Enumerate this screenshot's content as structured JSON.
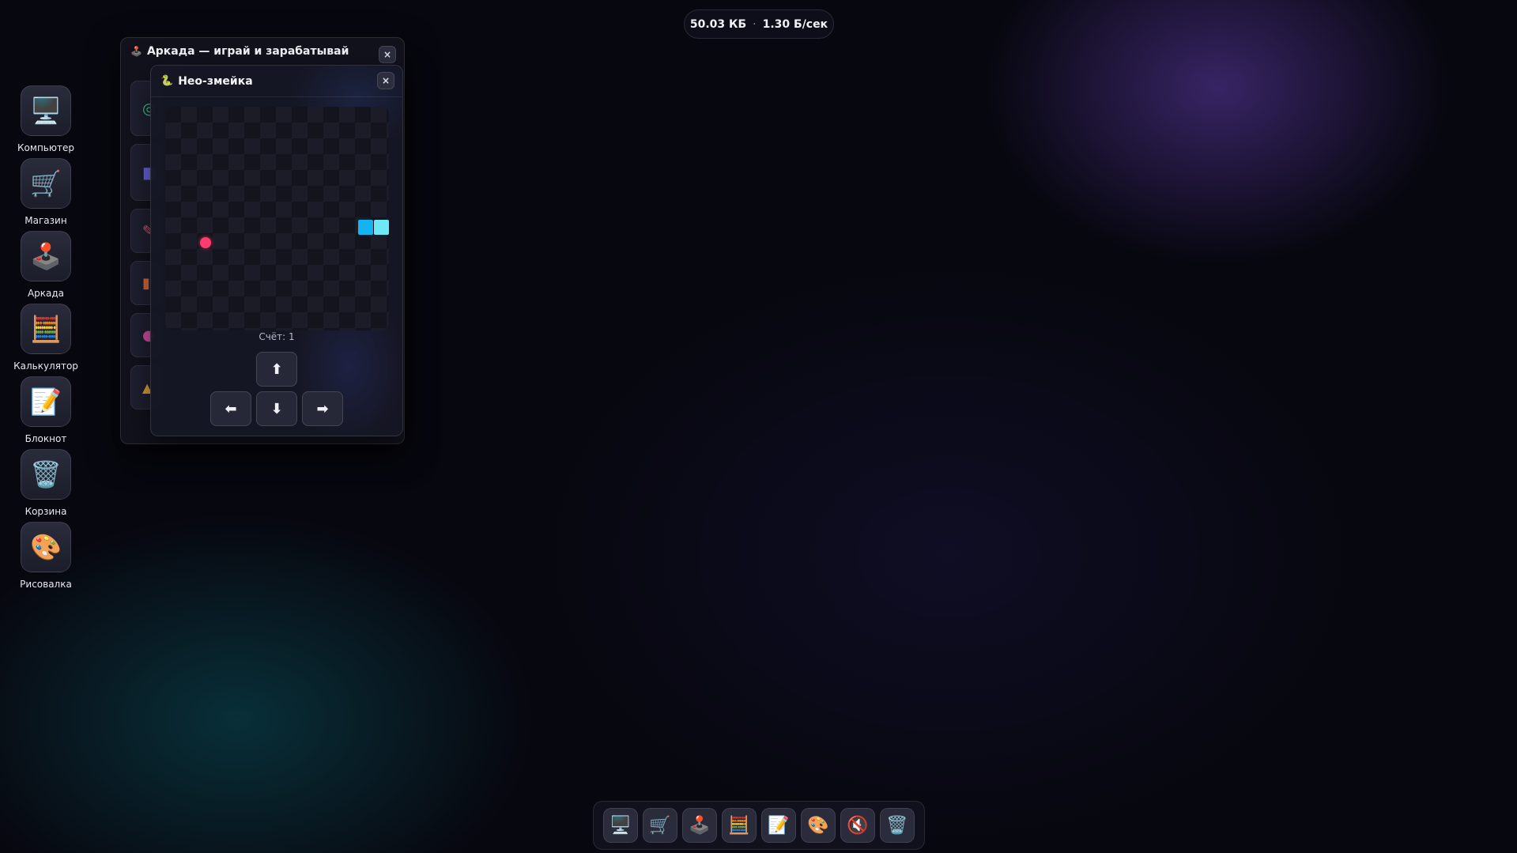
{
  "status": {
    "size": "50.03 КБ",
    "separator": "·",
    "rate": "1.30 Б/сек"
  },
  "desktop": {
    "items": [
      {
        "label": "Компьютер",
        "icon": "computer-icon",
        "glyph": "🖥️"
      },
      {
        "label": "Магазин",
        "icon": "cart-icon",
        "glyph": "🛒"
      },
      {
        "label": "Аркада",
        "icon": "joystick-icon",
        "glyph": "🕹️"
      },
      {
        "label": "Калькулятор",
        "icon": "abacus-icon",
        "glyph": "🧮"
      },
      {
        "label": "Блокнот",
        "icon": "notepad-icon",
        "glyph": "📝"
      },
      {
        "label": "Корзина",
        "icon": "trash-icon",
        "glyph": "🗑️"
      },
      {
        "label": "Рисовалка",
        "icon": "palette-icon",
        "glyph": "🎨"
      }
    ]
  },
  "arcade": {
    "title": "Аркада — играй и зарабатывай",
    "close": "×",
    "icon_glyph": "🕹️"
  },
  "snake": {
    "title": "Нео-змейка",
    "close": "×",
    "icon_glyph": "🐍",
    "score_label": "Счёт: 1",
    "food": {
      "col": 2,
      "row": 8
    },
    "segments": [
      {
        "col": 12,
        "row": 7,
        "color": "#14b4f0"
      },
      {
        "col": 13,
        "row": 7,
        "color": "#6ee8f6"
      }
    ],
    "grid": 14,
    "controls": {
      "up": "⬆",
      "left": "⬅",
      "down": "⬇",
      "right": "➡"
    }
  },
  "taskbar": {
    "items": [
      {
        "icon": "computer-icon",
        "glyph": "🖥️"
      },
      {
        "icon": "cart-icon",
        "glyph": "🛒"
      },
      {
        "icon": "joystick-icon",
        "glyph": "🕹️"
      },
      {
        "icon": "abacus-icon",
        "glyph": "🧮"
      },
      {
        "icon": "notepad-icon",
        "glyph": "📝"
      },
      {
        "icon": "palette-icon",
        "glyph": "🎨"
      },
      {
        "icon": "mute-icon",
        "glyph": "🔇"
      },
      {
        "icon": "trash-icon",
        "glyph": "🗑️"
      }
    ]
  }
}
